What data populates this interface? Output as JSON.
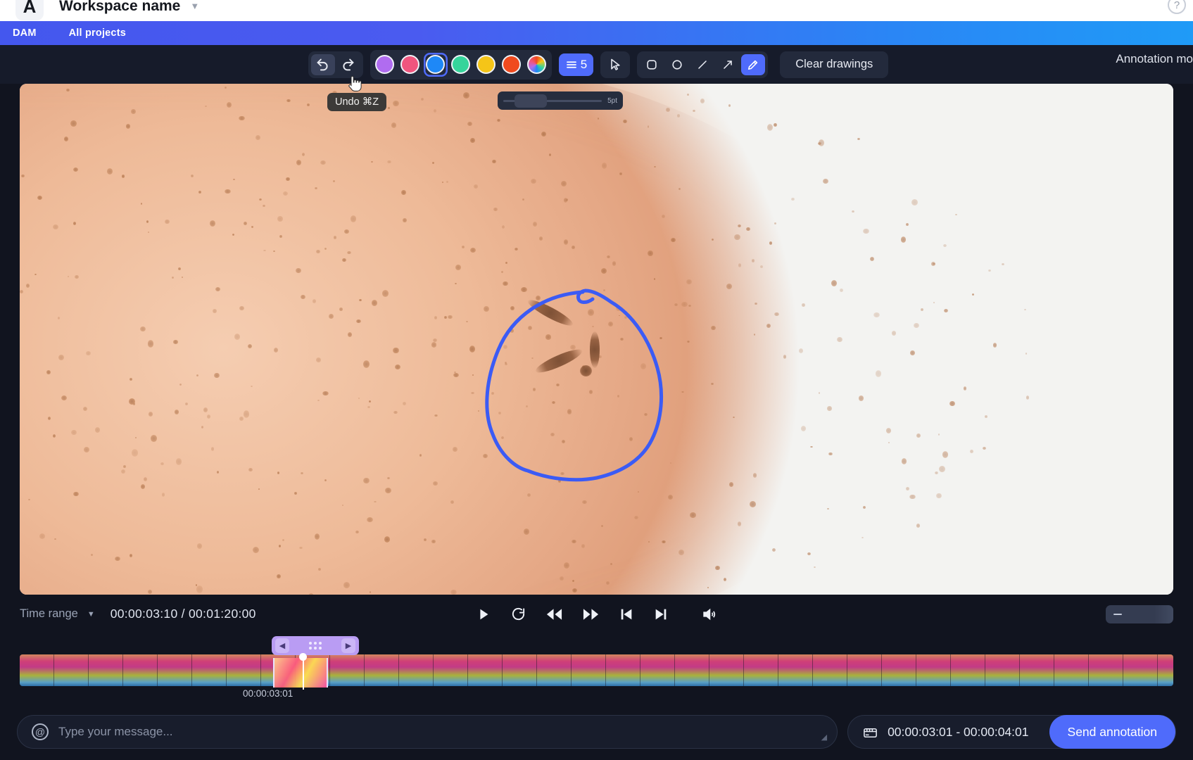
{
  "workspace": {
    "logo_letter": "A",
    "name": "Workspace name",
    "caret": "▼",
    "help_icon": "?"
  },
  "nav": {
    "items": [
      {
        "label": "DAM",
        "name": "nav-item-dam"
      },
      {
        "label": "All projects",
        "name": "nav-item-all-projects"
      }
    ],
    "accent": "#4457ee"
  },
  "toolbar": {
    "undo_label": "Undo",
    "redo_label": "Redo",
    "colors": [
      {
        "name": "purple",
        "hex": "#b06cf0",
        "selected": false
      },
      {
        "name": "pink",
        "hex": "#f0557e",
        "selected": false
      },
      {
        "name": "blue",
        "hex": "#1e88f7",
        "selected": true
      },
      {
        "name": "green",
        "hex": "#35d49b",
        "selected": false
      },
      {
        "name": "yellow",
        "hex": "#f5c518",
        "selected": false
      },
      {
        "name": "red",
        "hex": "#f04a1e",
        "selected": false
      },
      {
        "name": "rainbow",
        "hex": "rainbow",
        "selected": false
      }
    ],
    "thickness_value": "5",
    "thickness_slider_label": "5pt",
    "tools": [
      {
        "name": "cursor-tool",
        "active": false
      },
      {
        "name": "rectangle-tool",
        "active": false
      },
      {
        "name": "ellipse-tool",
        "active": false
      },
      {
        "name": "line-tool",
        "active": false
      },
      {
        "name": "arrow-tool",
        "active": false
      },
      {
        "name": "pencil-tool",
        "active": true
      }
    ],
    "clear_label": "Clear drawings",
    "annotation_mode_label": "Annotation mo",
    "tooltip": "Undo ⌘Z",
    "accent_blue": "#4f6bfb"
  },
  "player": {
    "time_range_label": "Time range",
    "time_range_caret": "▼",
    "current_time": "00:00:03:10",
    "total_time": "00:01:20:00",
    "timecode_display": "00:00:03:10 / 00:01:20:00",
    "controls": [
      {
        "name": "play-button"
      },
      {
        "name": "loop-button"
      },
      {
        "name": "rewind-button"
      },
      {
        "name": "fast-forward-button"
      },
      {
        "name": "skip-previous-button"
      },
      {
        "name": "skip-next-button"
      }
    ],
    "volume_icon": "volume-icon",
    "zoom_minus_label": "−"
  },
  "timeline": {
    "selection_time": "00:00:03:01",
    "left_arrow": "◀",
    "right_arrow": "▶",
    "frame_count": 34
  },
  "composer": {
    "mention_icon": "@",
    "message_placeholder": "Type your message...",
    "message_value": "",
    "annotation_range": "00:00:03:01 - 00:00:04:01",
    "send_label": "Send annotation"
  },
  "drawing": {
    "stroke_color": "#3b5bf5",
    "stroke_width": "5"
  }
}
